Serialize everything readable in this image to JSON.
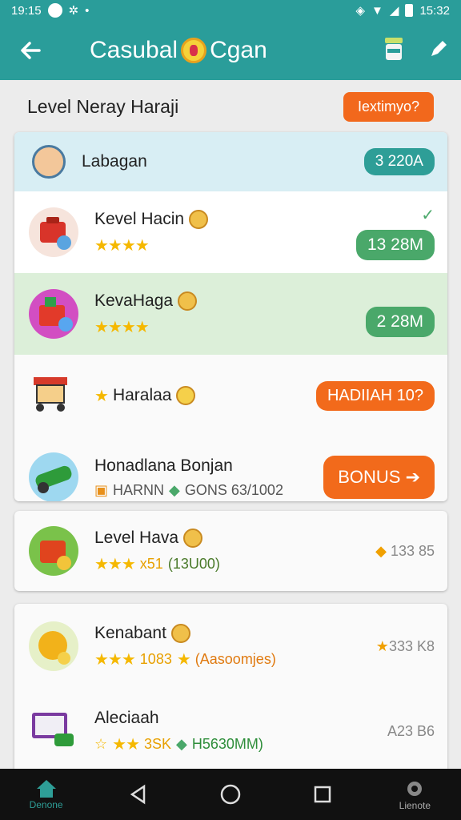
{
  "status": {
    "time_left": "19:15",
    "time_right": "15:32"
  },
  "appbar": {
    "title_part1": "Casubal",
    "title_part2": "Cgan"
  },
  "header": {
    "title": "Level Neray Haraji",
    "button": "Iextimyo?"
  },
  "card1": {
    "header_row": {
      "name": "Labagan",
      "pill": "3 220A"
    },
    "rows": [
      {
        "name": "Kevel Hacin",
        "stars": "★★★★",
        "pill": "13 28M",
        "check": "✓"
      },
      {
        "name": "KevaHaga",
        "stars": "★★★★",
        "pill": "2 28M"
      },
      {
        "name": "Haralaa",
        "pill": "HADIIAH 10?"
      },
      {
        "name": "Honadlana Bonjan",
        "sub_a": "HARNN",
        "sub_b": "GONS 63/1002",
        "pill": "BONUS ➔"
      }
    ]
  },
  "card2": {
    "name": "Level Hava",
    "stars": "★★★",
    "stars_suffix": "x51",
    "paren": "(13U00)",
    "mini": "133 85"
  },
  "card3": {
    "rows": [
      {
        "name": "Kenabant",
        "stars": "★★★",
        "value": "1083",
        "paren": "(Aasoomjes)",
        "mini": "333 K8"
      },
      {
        "name": "Aleciaah",
        "stars": "★★",
        "value": "3SK",
        "sub": "H5630MM)",
        "mini": "A23 B6"
      }
    ]
  },
  "nav": {
    "home": "Denone",
    "settings": "Lienote"
  },
  "colors": {
    "primary": "#2a9d9a",
    "accent": "#f26a1b",
    "green": "#4aa86a",
    "star": "#f5b800"
  }
}
